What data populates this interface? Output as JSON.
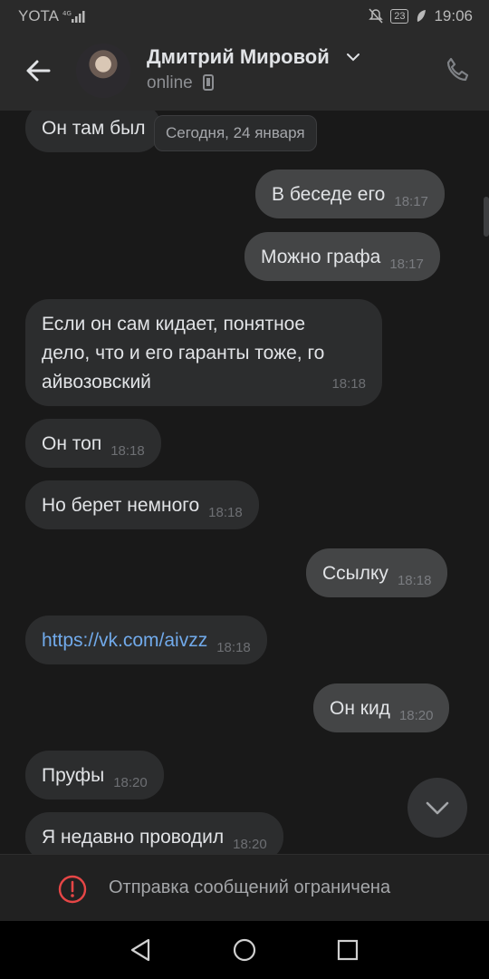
{
  "status_bar": {
    "carrier": "YOTA",
    "battery": "23",
    "time": "19:06"
  },
  "header": {
    "contact_name": "Дмитрий Мировой",
    "status": "online"
  },
  "date_pill": "Сегодня, 24 января",
  "messages": [
    {
      "text": "Он там был",
      "time": "",
      "direction": "in"
    },
    {
      "text": "В беседе его",
      "time": "18:17",
      "direction": "out"
    },
    {
      "text": "Можно графа",
      "time": "18:17",
      "direction": "out"
    },
    {
      "text_lines": [
        "Если он сам кидает, понятное",
        "дело, что и его гаранты тоже, го",
        "айвозовский"
      ],
      "time": "18:18",
      "direction": "in"
    },
    {
      "text": "Он топ",
      "time": "18:18",
      "direction": "in"
    },
    {
      "text": "Но берет немного",
      "time": "18:18",
      "direction": "in"
    },
    {
      "text": "Ссылку",
      "time": "18:18",
      "direction": "out"
    },
    {
      "text": "https://vk.com/aivzz",
      "time": "18:18",
      "direction": "in",
      "is_link": true
    },
    {
      "text": "Он кид",
      "time": "18:20",
      "direction": "out"
    },
    {
      "text": "Пруфы",
      "time": "18:20",
      "direction": "in"
    },
    {
      "text": "Я недавно проводил",
      "time": "18:20",
      "direction": "in"
    }
  ],
  "restriction": {
    "text": "Отправка сообщений ограничена",
    "icon": "warning-icon"
  },
  "colors": {
    "background": "#191919",
    "incoming_bubble": "#2c2d2e",
    "outgoing_bubble": "#444546",
    "link": "#71aaeb",
    "warning": "#e64646"
  }
}
